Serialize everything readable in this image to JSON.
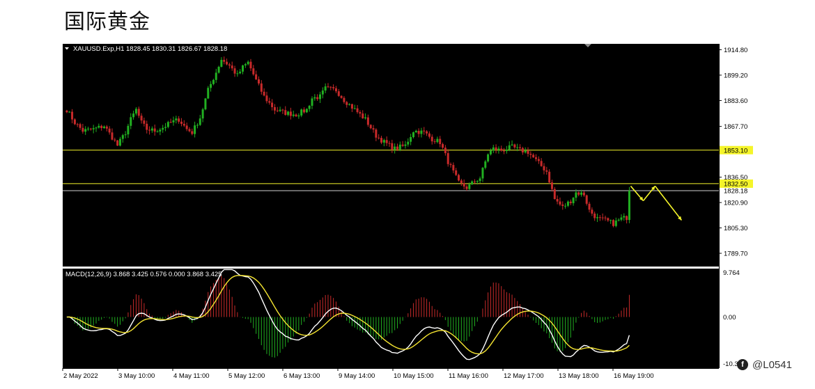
{
  "page": {
    "title": "国际黄金"
  },
  "watermark": {
    "text": "@L0541"
  },
  "chart_data": [
    {
      "type": "candlestick",
      "symbol_header": "XAUUSD.Exp,H1  1828.45 1830.31 1826.67 1828.18",
      "ylim": [
        1782,
        1918
      ],
      "y_ticks": [
        1914.8,
        1899.2,
        1883.6,
        1867.7,
        1836.5,
        1820.9,
        1805.3,
        1789.7
      ],
      "x_labels": [
        "2 May 2022",
        "3 May 10:00",
        "4 May 11:00",
        "5 May 12:00",
        "6 May 13:00",
        "9 May 14:00",
        "10 May 15:00",
        "11 May 16:00",
        "12 May 17:00",
        "13 May 18:00",
        "16 May 19:00"
      ],
      "n_bars": 212,
      "levels": [
        {
          "value": 1853.1,
          "label": "1853.10",
          "color": "#f5f52a",
          "boxed": true
        },
        {
          "value": 1832.5,
          "label": "1832.50",
          "color": "#f5f52a",
          "boxed": true
        },
        {
          "value": 1828.18,
          "label": "1828.18",
          "color": "#d0d0d0",
          "boxed": false
        }
      ],
      "anchors": [
        [
          0,
          1878
        ],
        [
          3,
          1870
        ],
        [
          6,
          1865
        ],
        [
          10,
          1866
        ],
        [
          14,
          1868
        ],
        [
          17,
          1861
        ],
        [
          19,
          1856
        ],
        [
          22,
          1864
        ],
        [
          24,
          1872
        ],
        [
          26,
          1878
        ],
        [
          28,
          1870
        ],
        [
          30,
          1866
        ],
        [
          33,
          1865
        ],
        [
          36,
          1867
        ],
        [
          39,
          1870
        ],
        [
          42,
          1872
        ],
        [
          45,
          1866
        ],
        [
          47,
          1864
        ],
        [
          50,
          1873
        ],
        [
          53,
          1890
        ],
        [
          56,
          1901
        ],
        [
          58,
          1909
        ],
        [
          61,
          1905
        ],
        [
          64,
          1899
        ],
        [
          66,
          1904
        ],
        [
          68,
          1907
        ],
        [
          71,
          1896
        ],
        [
          74,
          1886
        ],
        [
          78,
          1878
        ],
        [
          82,
          1876
        ],
        [
          86,
          1875
        ],
        [
          90,
          1878
        ],
        [
          92,
          1885
        ],
        [
          95,
          1886
        ],
        [
          97,
          1891
        ],
        [
          101,
          1890
        ],
        [
          104,
          1884
        ],
        [
          108,
          1878
        ],
        [
          112,
          1872
        ],
        [
          116,
          1862
        ],
        [
          119,
          1858
        ],
        [
          123,
          1854
        ],
        [
          127,
          1856
        ],
        [
          130,
          1865
        ],
        [
          134,
          1864
        ],
        [
          137,
          1860
        ],
        [
          140,
          1858
        ],
        [
          143,
          1846
        ],
        [
          147,
          1833
        ],
        [
          150,
          1830
        ],
        [
          153,
          1834
        ],
        [
          155,
          1836
        ],
        [
          158,
          1851
        ],
        [
          160,
          1854
        ],
        [
          163,
          1853
        ],
        [
          167,
          1855
        ],
        [
          170,
          1853
        ],
        [
          173,
          1852
        ],
        [
          177,
          1845
        ],
        [
          180,
          1840
        ],
        [
          183,
          1823
        ],
        [
          186,
          1818
        ],
        [
          189,
          1822
        ],
        [
          191,
          1827
        ],
        [
          194,
          1826
        ],
        [
          196,
          1816
        ],
        [
          199,
          1811
        ],
        [
          202,
          1810
        ],
        [
          205,
          1808
        ],
        [
          208,
          1811
        ],
        [
          211,
          1812
        ],
        [
          214,
          1806
        ],
        [
          217,
          1800
        ],
        [
          219,
          1794
        ],
        [
          222,
          1801
        ],
        [
          225,
          1808
        ],
        [
          227,
          1815
        ],
        [
          230,
          1823
        ],
        [
          233,
          1826
        ],
        [
          236,
          1827
        ],
        [
          239,
          1822
        ],
        [
          241,
          1825
        ],
        [
          243,
          1828
        ]
      ],
      "forecast_arrows": [
        {
          "color": "#f5f52a",
          "points": [
            [
              1824,
              1831
            ],
            [
              1830,
              1822
            ]
          ]
        },
        {
          "color": "#f5f52a",
          "points": [
            [
              1830,
              1822
            ],
            [
              1836,
              1831
            ]
          ]
        },
        {
          "color": "#f5f52a",
          "points": [
            [
              1836,
              1831
            ],
            [
              1810,
              0
            ]
          ]
        }
      ],
      "up_color": "#21b021",
      "down_color": "#c82a2a"
    },
    {
      "type": "macd",
      "header": "MACD(12,26,9) 3.868 3.425 0.576 0.000 3.868 3.425",
      "params": [
        12,
        26,
        9
      ],
      "y_ticks": [
        9.764,
        0.0,
        -10.318
      ],
      "y_ticks_label": [
        "9.764",
        "0.00",
        "-10.3"
      ],
      "ylim": [
        -10.318,
        9.764
      ],
      "macd_color": "#ffffff",
      "signal_color": "#f5e531",
      "hist_up_color": "#c82a2a",
      "hist_down_color": "#21b021"
    }
  ]
}
